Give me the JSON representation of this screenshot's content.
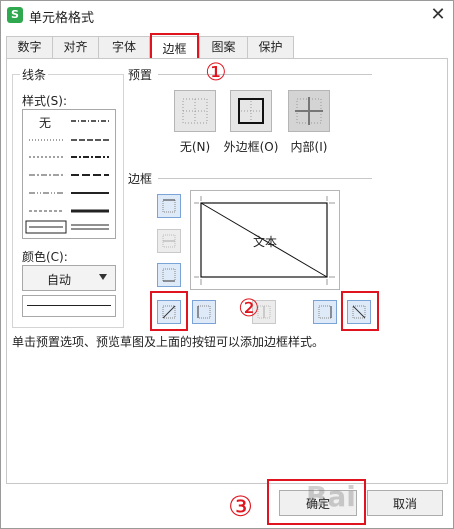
{
  "window": {
    "title": "单元格格式",
    "app_icon_letter": "S",
    "close": "✕"
  },
  "tabs": [
    {
      "label": "数字",
      "active": false
    },
    {
      "label": "对齐",
      "active": false
    },
    {
      "label": "字体",
      "active": false
    },
    {
      "label": "边框",
      "active": true
    },
    {
      "label": "图案",
      "active": false
    },
    {
      "label": "保护",
      "active": false
    }
  ],
  "line_group": {
    "label": "线条",
    "style_label": "样式(S):",
    "none_label": "无",
    "color_label": "颜色(C):",
    "color_value": "自动"
  },
  "presets": {
    "label": "预置",
    "items": [
      {
        "label": "无(N)",
        "icon": "no-border-icon"
      },
      {
        "label": "外边框(O)",
        "icon": "outline-border-icon"
      },
      {
        "label": "内部(I)",
        "icon": "inside-border-icon"
      }
    ]
  },
  "border": {
    "label": "边框",
    "preview_text": "文本"
  },
  "hint": "单击预置选项、预览草图及上面的按钮可以添加边框样式。",
  "buttons": {
    "ok": "确定",
    "cancel": "取消"
  },
  "annotations": {
    "step1": "①",
    "step2": "②",
    "step3": "③"
  },
  "watermark": "Bai",
  "colors": {
    "highlight_red": "#e0141e",
    "button_blue_bg": "#dfeaf8",
    "button_blue_border": "#7aa3d8"
  }
}
